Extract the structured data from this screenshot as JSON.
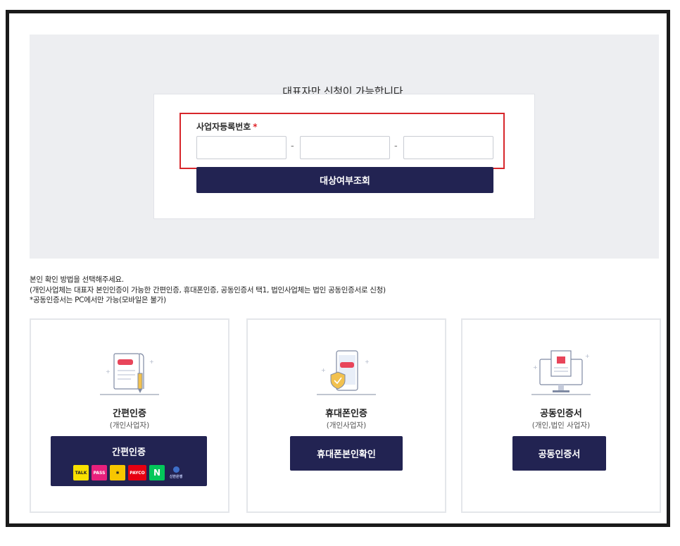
{
  "notice": "대표자만 신청이 가능합니다.",
  "business_number": {
    "label": "사업자등록번호",
    "required_mark": "*",
    "part1": "",
    "part2": "",
    "part3": "",
    "separator": "-"
  },
  "lookup_button": "대상여부조회",
  "instructions": [
    "본인 확인 방법을 선택해주세요.",
    "(개인사업체는 대표자 본인인증이 가능한 간편인증, 휴대폰인증, 공동인증서 택1, 법인사업체는 법인 공동인증서로 신청)",
    "*공동인증서는 PC에서만 가능(모바일은 불가)"
  ],
  "methods": [
    {
      "title": "간편인증",
      "subtitle": "(개인사업자)",
      "button": "간편인증",
      "icon": "document-pen-icon",
      "providers": [
        {
          "name": "kakao-icon",
          "text": "TALK"
        },
        {
          "name": "pass-icon",
          "text": "PASS"
        },
        {
          "name": "payco-alt-icon",
          "text": "✱"
        },
        {
          "name": "payco-icon",
          "text": "PAYCO"
        },
        {
          "name": "naver-icon",
          "text": "N"
        },
        {
          "name": "shinhan-icon",
          "text": "신한은행"
        }
      ]
    },
    {
      "title": "휴대폰인증",
      "subtitle": "(개인사업자)",
      "button": "휴대폰본인확인",
      "icon": "phone-shield-icon"
    },
    {
      "title": "공동인증서",
      "subtitle": "(개인,법인 사업자)",
      "button": "공동인증서",
      "icon": "certificate-monitor-icon"
    }
  ],
  "colors": {
    "primary": "#222352",
    "highlight": "#d7262b",
    "panel_bg": "#edeef1"
  }
}
